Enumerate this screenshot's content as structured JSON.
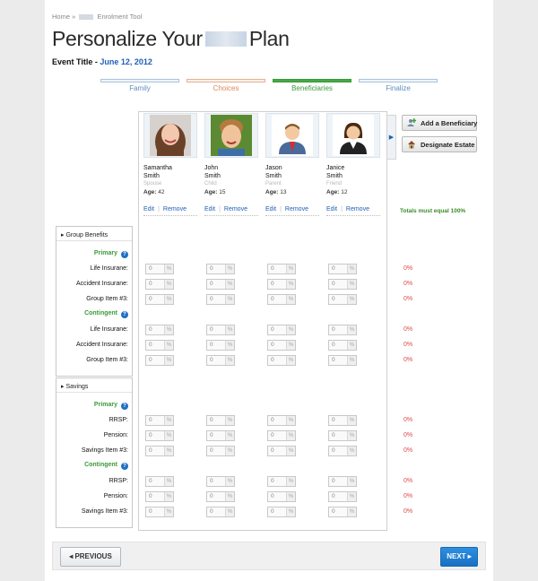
{
  "breadcrumb": {
    "home": "Home",
    "sep": "»",
    "tool": "Enrolment Tool"
  },
  "page_title": {
    "left": "Personalize Your",
    "right": "Plan"
  },
  "event": {
    "label": "Event Title - ",
    "date": "June 12, 2012"
  },
  "steps": [
    "Family",
    "Choices",
    "Beneficiaries",
    "Finalize"
  ],
  "beneficiaries": [
    {
      "first": "Samantha",
      "last": "Smith",
      "relation": "Spouse",
      "age_label": "Age:",
      "age": "42",
      "icon": "woman-photo-icon"
    },
    {
      "first": "John",
      "last": "Smith",
      "relation": "Child",
      "age_label": "Age:",
      "age": "15",
      "icon": "boy-photo-icon"
    },
    {
      "first": "Jason",
      "last": "Smith",
      "relation": "Parent",
      "age_label": "Age:",
      "age": "13",
      "icon": "man-avatar-icon"
    },
    {
      "first": "Janice",
      "last": "Smith",
      "relation": "Friend",
      "age_label": "Age:",
      "age": "12",
      "icon": "woman-avatar-icon"
    }
  ],
  "card_actions": {
    "edit": "Edit",
    "sep": "|",
    "remove": "Remove"
  },
  "scroll_arrow": "▶",
  "buttons": {
    "add": "Add a Beneficiary",
    "estate": "Designate Estate",
    "previous": "◂ PREVIOUS",
    "next": "NEXT ▸"
  },
  "totals_note": "Totals must equal 100%",
  "sections": [
    {
      "title": "▸ Group Benefits",
      "primary": "Primary",
      "contingent": "Contingent",
      "items": [
        "Life Insurane:",
        "Accident Insurane:",
        "Group Item #3:"
      ]
    },
    {
      "title": "▸ Savings",
      "primary": "Primary",
      "contingent": "Contingent",
      "items": [
        "RRSP:",
        "Pension:",
        "Savings Item #3:"
      ]
    }
  ],
  "input_default": "0",
  "input_unit": "%",
  "row_total": "0%",
  "help_glyph": "?",
  "colors": {
    "accent_blue": "#1f5fb5",
    "group_green": "#3a9a3a",
    "total_red": "#e04848",
    "next_button": "#1f7fd4"
  }
}
